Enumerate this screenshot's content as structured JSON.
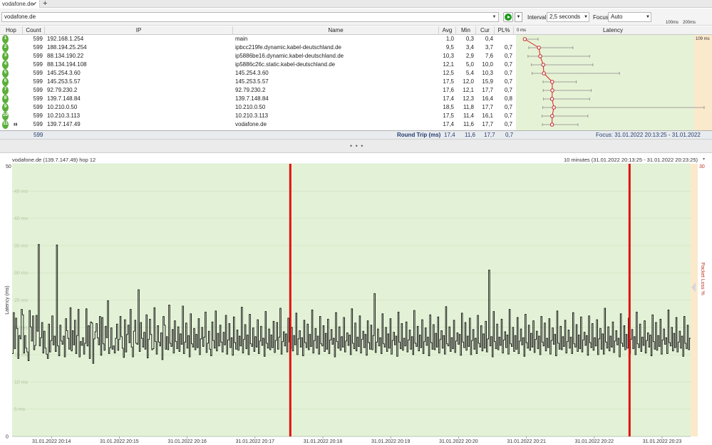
{
  "tab": {
    "title": "vodafone.de",
    "close": "✔",
    "new": "+"
  },
  "toolbar": {
    "target": "vodafone.de",
    "interval_label": "Interval",
    "interval_value": "2,5 seconds",
    "focus_label": "Focus",
    "focus_value": "Auto",
    "scale_100": "100ms",
    "scale_200": "200ms"
  },
  "columns": {
    "hop": "Hop",
    "count": "Count",
    "ip": "IP",
    "name": "Name",
    "avg": "Avg",
    "min": "Min",
    "cur": "Cur",
    "pl": "PL%",
    "latency": "Latency",
    "lat_min": "0 ms",
    "lat_max": "109 ms"
  },
  "hops": [
    {
      "hop": "1",
      "count": "599",
      "ip": "192.168.1.254",
      "name": "main",
      "avg": "1,0",
      "min": "0,3",
      "cur": "0,4",
      "pl": "",
      "avg_ms": 1.0,
      "min_ms": 0.3,
      "max_ms": 9
    },
    {
      "hop": "2",
      "count": "599",
      "ip": "188.194.25.254",
      "name": "ipbcc219fe.dynamic.kabel-deutschland.de",
      "avg": "9,5",
      "min": "3,4",
      "cur": "3,7",
      "pl": "0,7",
      "avg_ms": 9.5,
      "min_ms": 3.4,
      "max_ms": 30
    },
    {
      "hop": "3",
      "count": "599",
      "ip": "88.134.190.22",
      "name": "ip5886be16.dynamic.kabel-deutschland.de",
      "avg": "10,3",
      "min": "2,9",
      "cur": "7,6",
      "pl": "0,7",
      "avg_ms": 10.3,
      "min_ms": 2.9,
      "max_ms": 40
    },
    {
      "hop": "4",
      "count": "599",
      "ip": "88.134.194.108",
      "name": "ip5886c26c.static.kabel-deutschland.de",
      "avg": "12,1",
      "min": "5,0",
      "cur": "10,0",
      "pl": "0,7",
      "avg_ms": 12.1,
      "min_ms": 5.0,
      "max_ms": 42
    },
    {
      "hop": "5",
      "count": "599",
      "ip": "145.254.3.60",
      "name": "145.254.3.60",
      "avg": "12,5",
      "min": "5,4",
      "cur": "10,3",
      "pl": "0,7",
      "avg_ms": 12.5,
      "min_ms": 5.4,
      "max_ms": 58
    },
    {
      "hop": "6",
      "count": "599",
      "ip": "145.253.5.57",
      "name": "145.253.5.57",
      "avg": "17,5",
      "min": "12,0",
      "cur": "15,9",
      "pl": "0,7",
      "avg_ms": 17.5,
      "min_ms": 12.0,
      "max_ms": 32
    },
    {
      "hop": "7",
      "count": "599",
      "ip": "92.79.230.2",
      "name": "92.79.230.2",
      "avg": "17,6",
      "min": "12,1",
      "cur": "17,7",
      "pl": "0,7",
      "avg_ms": 17.6,
      "min_ms": 12.1,
      "max_ms": 41
    },
    {
      "hop": "8",
      "count": "599",
      "ip": "139.7.148.84",
      "name": "139.7.148.84",
      "avg": "17,4",
      "min": "12,3",
      "cur": "16,4",
      "pl": "0,8",
      "avg_ms": 17.4,
      "min_ms": 12.3,
      "max_ms": 40
    },
    {
      "hop": "9",
      "count": "599",
      "ip": "10.210.0.50",
      "name": "10.210.0.50",
      "avg": "18,5",
      "min": "11,8",
      "cur": "17,7",
      "pl": "0,7",
      "avg_ms": 18.5,
      "min_ms": 11.8,
      "max_ms": 109
    },
    {
      "hop": "10",
      "count": "599",
      "ip": "10.210.3.113",
      "name": "10.210.3.113",
      "avg": "17,5",
      "min": "11,4",
      "cur": "16,1",
      "pl": "0,7",
      "avg_ms": 17.5,
      "min_ms": 11.4,
      "max_ms": 39
    },
    {
      "hop": "11",
      "count": "599",
      "ip": "139.7.147.49",
      "name": "vodafone.de",
      "avg": "17,4",
      "min": "11,6",
      "cur": "17,7",
      "pl": "0,7",
      "avg_ms": 17.4,
      "min_ms": 11.6,
      "max_ms": 33
    }
  ],
  "summary": {
    "count": "599",
    "label": "Round Trip (ms)",
    "avg": "17,4",
    "min": "11,6",
    "cur": "17,7",
    "pl": "0,7",
    "focus": "Focus: 31.01.2022 20:13:25 - 31.01.2022 20:23:25"
  },
  "splitter": "• • •",
  "chart_panel": {
    "title": "vodafone.de (139.7.147.49) hop 12",
    "range": "10 minutes (31.01.2022 20:13:25 - 31.01.2022 20:23:25)",
    "range_dd": "▾"
  },
  "chart_data": {
    "type": "line",
    "ylabel": "Latency (ms)",
    "y2label": "Packet Loss %",
    "ylim": [
      0,
      50
    ],
    "y2lim": [
      0,
      30
    ],
    "y_ticks": [
      "0",
      "5 ms",
      "10 ms",
      "15 ms",
      "20 ms",
      "25 ms",
      "30 ms",
      "35 ms",
      "40 ms",
      "45 ms",
      "50"
    ],
    "y2_top": "30",
    "x_ticks": [
      "31.01.2022 20:14",
      "31.01.2022 20:15",
      "31.01.2022 20:16",
      "31.01.2022 20:17",
      "31.01.2022 20:18",
      "31.01.2022 20:19",
      "31.01.2022 20:20",
      "31.01.2022 20:21",
      "31.01.2022 20:22",
      "31.01.2022 20:23"
    ],
    "packet_loss_events_minutes": [
      4.1,
      9.1
    ],
    "series": [
      {
        "values": [
          15.2,
          22.7,
          16.1,
          21.7,
          19.8,
          14.3,
          18.5,
          17.9,
          23.3,
          22.3,
          15.3,
          18.5,
          16.2,
          15.5,
          13.9,
          23.1,
          20.1,
          17.5,
          22.1,
          15.9,
          16.7,
          22.2,
          19.3,
          35.2,
          16.6,
          18.1,
          20.9,
          15.3,
          19.3,
          16.2,
          15.1,
          14.3,
          20.6,
          15.5,
          17.6,
          22.1,
          16.8,
          18.4,
          15.6,
          35.1,
          16.6,
          14.8,
          20.4,
          17.5,
          16.9,
          18.4,
          14.6,
          21.6,
          19.4,
          18.0,
          16.0,
          23.6,
          15.7,
          19.4,
          16.8,
          21.3,
          15.2,
          18.5,
          23.3,
          14.6,
          17.4,
          16.7,
          18.1,
          15.1,
          17.1,
          23.4,
          16.6,
          20.3,
          14.3,
          21.0,
          20.8,
          13.4,
          17.9,
          19.2,
          20.7,
          18.1,
          16.8,
          22.0,
          14.9,
          21.8,
          17.0,
          15.8,
          20.2,
          18.1,
          24.9,
          15.2,
          16.3,
          19.9,
          16.0,
          16.6,
          15.3,
          18.0,
          20.6,
          15.8,
          17.8,
          22.0,
          18.3,
          16.2,
          14.5,
          21.4,
          15.5,
          18.7,
          20.4,
          17.2,
          23.3,
          16.4,
          14.6,
          19.3,
          21.3,
          17.1,
          16.9,
          26.9,
          15.6,
          20.9,
          18.0,
          16.4,
          19.1,
          16.0,
          22.3,
          14.4,
          17.8,
          21.5,
          18.7,
          15.9,
          16.1,
          23.6,
          17.4,
          15.1,
          20.3,
          17.3,
          16.6,
          19.0,
          14.1,
          22.0,
          20.4,
          16.0,
          18.3,
          15.9,
          24.1,
          17.1,
          16.5,
          19.6,
          15.3,
          21.2,
          17.4,
          16.1,
          20.1,
          15.6,
          18.8,
          16.9,
          23.9,
          15.2,
          17.3,
          20.8,
          16.2,
          18.5,
          14.6,
          22.5,
          17.0,
          16.4,
          19.8,
          15.9,
          18.7,
          16.3,
          21.6,
          15.0,
          17.9,
          20.0,
          16.5,
          18.2,
          22.8,
          15.4,
          17.1,
          19.3,
          16.0,
          14.8,
          21.0,
          17.6,
          16.2,
          23.0,
          15.7,
          18.9,
          16.6,
          20.4,
          17.3,
          15.5,
          19.1,
          16.8,
          22.2,
          15.1,
          17.7,
          20.7,
          16.3,
          18.1,
          14.9,
          21.9,
          17.2,
          16.0,
          19.5,
          15.8,
          18.4,
          16.6,
          23.7,
          15.3,
          17.8,
          20.5,
          16.1,
          18.6,
          15.0,
          22.4,
          17.0,
          16.5,
          19.9,
          15.6,
          18.3,
          16.4,
          21.4,
          15.2,
          17.5,
          20.2,
          16.7,
          18.0,
          14.7,
          22.9,
          17.1,
          16.2,
          19.7,
          15.9,
          18.6,
          16.3,
          21.1,
          15.4,
          17.6,
          20.9,
          16.0,
          18.2,
          23.5,
          15.1,
          17.4,
          19.2,
          16.6,
          18.8,
          15.5,
          21.7,
          17.3,
          16.1,
          20.0,
          15.7,
          18.5,
          16.8,
          22.6,
          15.0,
          17.9,
          19.4,
          16.4,
          18.1,
          14.8,
          21.3,
          17.2,
          16.3,
          20.6,
          15.9,
          18.7,
          16.5,
          23.2,
          15.3,
          17.6,
          19.8,
          16.2,
          18.4,
          15.1,
          22.0,
          17.0,
          16.6,
          20.3,
          15.6,
          18.9,
          16.0,
          21.5,
          15.2,
          17.7,
          19.6,
          16.9,
          18.0,
          14.6,
          22.7,
          17.4,
          16.2,
          20.1,
          15.8,
          18.3,
          16.4,
          21.8,
          15.5,
          17.5,
          19.0,
          16.7,
          18.6,
          15.0,
          23.4,
          17.1,
          16.1,
          20.8,
          15.7,
          18.2,
          16.5,
          22.1,
          15.3,
          17.8,
          19.3,
          16.3,
          18.7,
          14.9,
          21.2,
          17.2,
          16.0,
          20.4,
          15.9,
          18.5,
          26.2,
          15.4,
          17.3,
          19.7,
          16.6,
          18.1,
          15.2,
          22.5,
          17.0,
          16.4,
          20.0,
          15.6,
          18.8,
          16.2,
          21.6,
          15.1,
          17.6,
          19.1,
          16.8,
          18.4,
          14.7,
          22.8,
          17.3,
          16.1,
          20.7,
          15.8,
          18.0,
          16.6,
          21.0,
          15.5,
          17.7,
          19.5,
          16.0,
          18.3,
          15.0,
          23.1,
          17.1,
          16.5,
          20.2,
          15.7,
          18.6,
          16.3,
          21.4,
          15.2,
          17.4,
          19.9,
          16.7,
          18.2,
          14.8,
          22.3,
          17.2,
          16.0,
          20.5,
          15.9,
          18.9,
          16.4,
          21.9,
          15.3,
          17.8,
          19.4,
          16.2,
          18.5,
          15.1,
          23.8,
          17.0,
          16.6,
          20.1,
          15.6,
          18.1,
          16.1,
          21.3,
          15.4,
          17.5,
          19.0,
          16.9,
          18.7,
          14.9,
          22.6,
          17.3,
          16.3,
          20.9,
          15.8,
          18.4,
          16.5,
          21.7,
          15.0,
          17.6,
          19.6,
          16.0,
          18.0,
          15.2,
          22.2,
          17.1,
          16.4,
          20.3,
          15.7,
          18.8,
          16.2,
          21.1,
          15.5,
          17.9,
          30.5,
          16.6,
          18.3,
          14.6,
          22.9,
          17.4,
          16.1,
          20.6,
          15.9,
          18.2,
          16.7,
          21.5,
          15.3,
          17.7,
          19.2,
          16.3,
          18.6,
          15.1,
          23.3,
          17.0,
          16.5,
          20.0,
          15.6,
          18.5,
          16.0,
          21.8,
          15.2,
          17.5,
          19.7,
          16.8,
          18.1,
          14.7,
          22.4,
          17.2,
          16.2,
          20.4,
          15.8,
          18.9,
          16.4,
          21.2,
          15.4,
          17.8,
          19.3,
          16.1,
          18.4,
          15.0,
          22.0,
          17.3,
          16.6,
          20.8,
          15.7,
          18.0,
          16.3,
          21.6,
          15.1,
          17.6,
          19.9,
          16.9,
          18.7,
          14.8,
          23.0,
          17.1,
          16.0,
          20.2,
          15.9,
          18.3,
          16.5,
          21.3,
          15.3,
          17.4,
          19.5,
          16.2,
          18.2,
          15.2,
          22.7,
          17.0,
          16.4,
          20.5,
          15.6,
          18.6,
          16.1,
          21.9,
          15.5,
          17.7,
          19.1,
          16.7,
          18.5,
          14.9,
          22.1,
          17.2,
          16.3,
          20.7,
          15.8,
          18.1,
          16.6,
          21.4,
          15.0,
          17.9,
          19.8,
          16.0,
          18.8,
          15.1,
          23.5,
          17.3,
          16.2,
          20.1,
          15.7,
          18.4,
          16.4,
          21.0,
          15.4,
          17.5,
          19.4,
          16.8,
          18.0,
          14.6,
          22.5,
          17.1,
          16.5,
          20.3,
          15.9,
          18.7,
          16.2,
          21.7,
          15.2,
          17.8,
          19.6,
          16.1,
          18.3,
          15.0,
          22.8,
          17.0,
          16.3,
          20.6,
          15.6,
          18.2,
          16.7,
          21.2,
          15.3,
          17.6,
          19.0,
          16.4,
          18.6,
          14.8,
          22.3,
          17.4,
          16.0,
          20.9,
          15.8,
          18.5,
          16.5,
          21.5,
          15.1,
          17.7,
          19.7,
          16.9,
          18.1,
          15.2,
          23.2,
          17.2,
          16.6,
          20.0,
          15.7,
          18.9,
          16.3,
          21.8,
          15.5,
          17.3,
          19.3,
          16.2,
          18.4,
          14.7,
          22.0,
          17.1,
          16.1,
          20.4,
          15.9,
          18.0
        ]
      }
    ]
  }
}
